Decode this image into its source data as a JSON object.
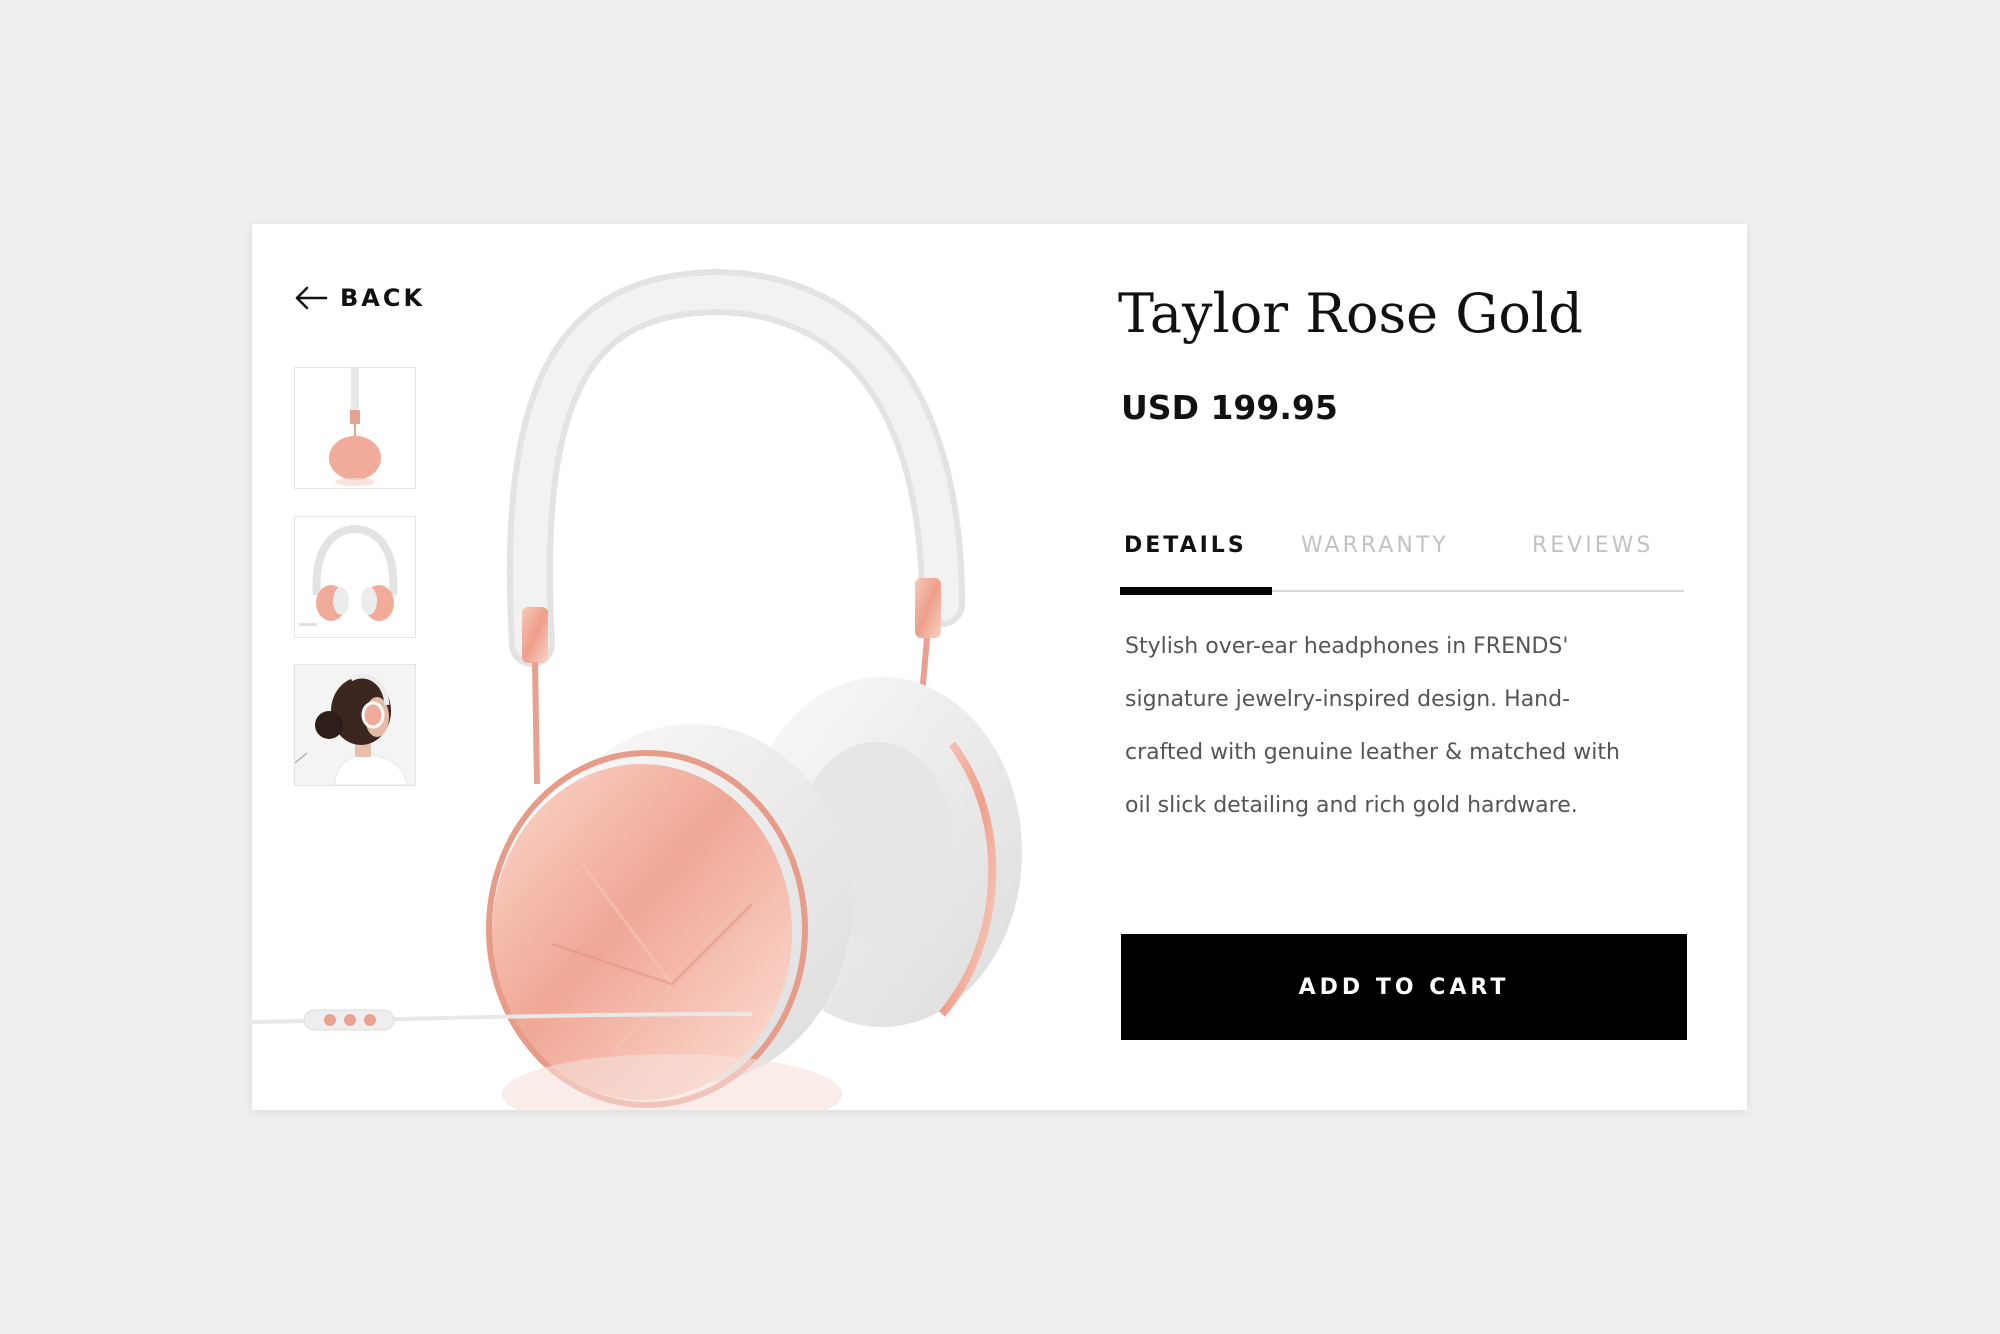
{
  "nav": {
    "back_label": "BACK"
  },
  "product": {
    "title": "Taylor Rose Gold",
    "price": "USD 199.95",
    "description": "Stylish over-ear headphones in FRENDS' signature jewelry-inspired design. Hand-crafted with genuine leather & matched with oil slick detailing and rich gold hardware."
  },
  "tabs": [
    {
      "label": "DETAILS",
      "active": true
    },
    {
      "label": "WARRANTY",
      "active": false
    },
    {
      "label": "REVIEWS",
      "active": false
    }
  ],
  "gallery": {
    "thumbnails": [
      {
        "name": "headphones-side-view"
      },
      {
        "name": "headphones-front-view"
      },
      {
        "name": "model-wearing-headphones"
      }
    ]
  },
  "actions": {
    "add_to_cart_label": "ADD TO CART"
  },
  "colors": {
    "accent": "#000000",
    "rose_gold": "#e9a28f",
    "background": "#efefef",
    "card": "#ffffff",
    "inactive_tab": "#c2c2c2"
  },
  "icons": {
    "back": "arrow-left-icon"
  }
}
